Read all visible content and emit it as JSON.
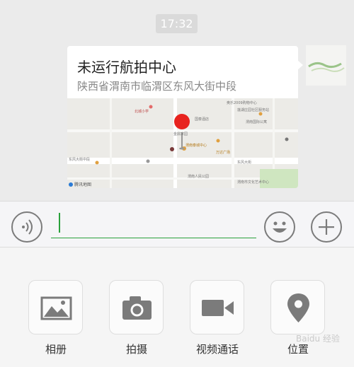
{
  "status": {
    "time": "17:32"
  },
  "location_message": {
    "title": "未运行航拍中心",
    "address": "陕西省渭南市临渭区东风大街中段",
    "map_labels": {
      "poi_1": "奥乐2009购物中心",
      "poi_2": "莲湖庄园社区服务站",
      "poi_3": "北城小学",
      "poi_4": "渭南国际公寓",
      "poi_5": "国泰酒店",
      "poi_6": "金鼎家园",
      "poi_7": "渭南泰城中心",
      "poi_8": "东风大街中段",
      "poi_9": "东风大街",
      "poi_10": "万达广场",
      "poi_11": "渭南人民公园",
      "poi_12": "渭南市文化艺术中心",
      "map_brand": "腾讯地图"
    }
  },
  "input_bar": {
    "placeholder": "",
    "value": ""
  },
  "attachments": [
    {
      "label": "相册",
      "icon": "photo-album-icon"
    },
    {
      "label": "拍摄",
      "icon": "camera-icon"
    },
    {
      "label": "视频通话",
      "icon": "video-call-icon"
    },
    {
      "label": "位置",
      "icon": "location-icon"
    }
  ],
  "watermark": "Baidu 经验",
  "colors": {
    "accent_green": "#2aa13b",
    "pin_red": "#e8231f",
    "icon_gray": "#7b7b7b"
  }
}
